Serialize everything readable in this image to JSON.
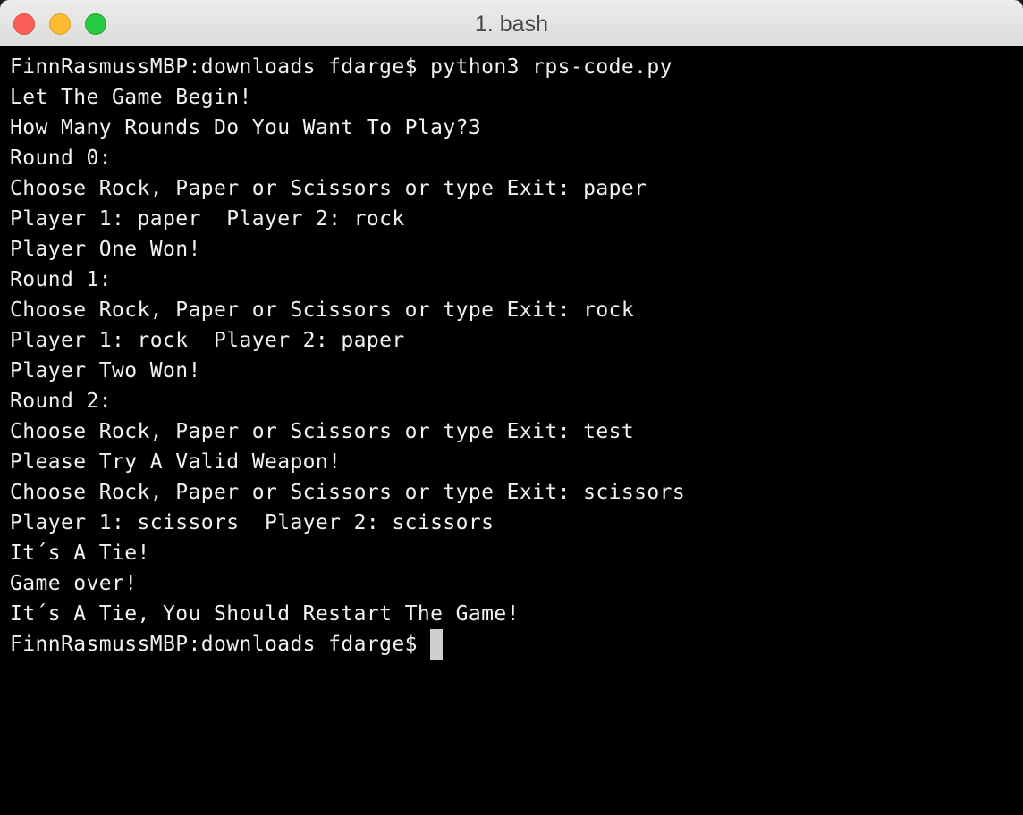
{
  "window": {
    "title": "1. bash"
  },
  "terminal": {
    "lines": [
      "FinnRasmussMBP:downloads fdarge$ python3 rps-code.py",
      "Let The Game Begin!",
      "How Many Rounds Do You Want To Play?3",
      "Round 0:",
      "Choose Rock, Paper or Scissors or type Exit: paper",
      "Player 1: paper  Player 2: rock",
      "Player One Won!",
      "Round 1:",
      "Choose Rock, Paper or Scissors or type Exit: rock",
      "Player 1: rock  Player 2: paper",
      "Player Two Won!",
      "Round 2:",
      "Choose Rock, Paper or Scissors or type Exit: test",
      "Please Try A Valid Weapon!",
      "Choose Rock, Paper or Scissors or type Exit: scissors",
      "Player 1: scissors  Player 2: scissors",
      "It´s A Tie!",
      "Game over!",
      "It´s A Tie, You Should Restart The Game!"
    ],
    "prompt": "FinnRasmussMBP:downloads fdarge$ "
  }
}
